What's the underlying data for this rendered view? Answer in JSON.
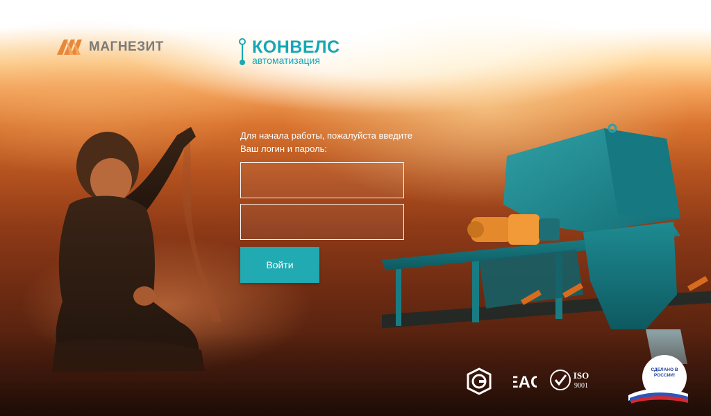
{
  "brand": {
    "partner_name": "МАГНЕЗИТ",
    "partner_icon": "magnezit-logo-icon",
    "company_name": "КОНВЕЛС",
    "company_subtitle": "автоматизация",
    "company_color": "#13a8b4"
  },
  "login": {
    "prompt": "Для начала работы, пожалуйста введите Ваш логин и пароль:",
    "login_value": "",
    "password_value": "",
    "submit_label": "Войти",
    "accent_color": "#22aab2"
  },
  "certifications": {
    "gost_icon": "gost-certification-icon",
    "eac_text": "EAC",
    "iso_text": "ISO",
    "iso_number": "9001",
    "russia_badge_text": "СДЕЛАНО В РОССИИ!"
  }
}
